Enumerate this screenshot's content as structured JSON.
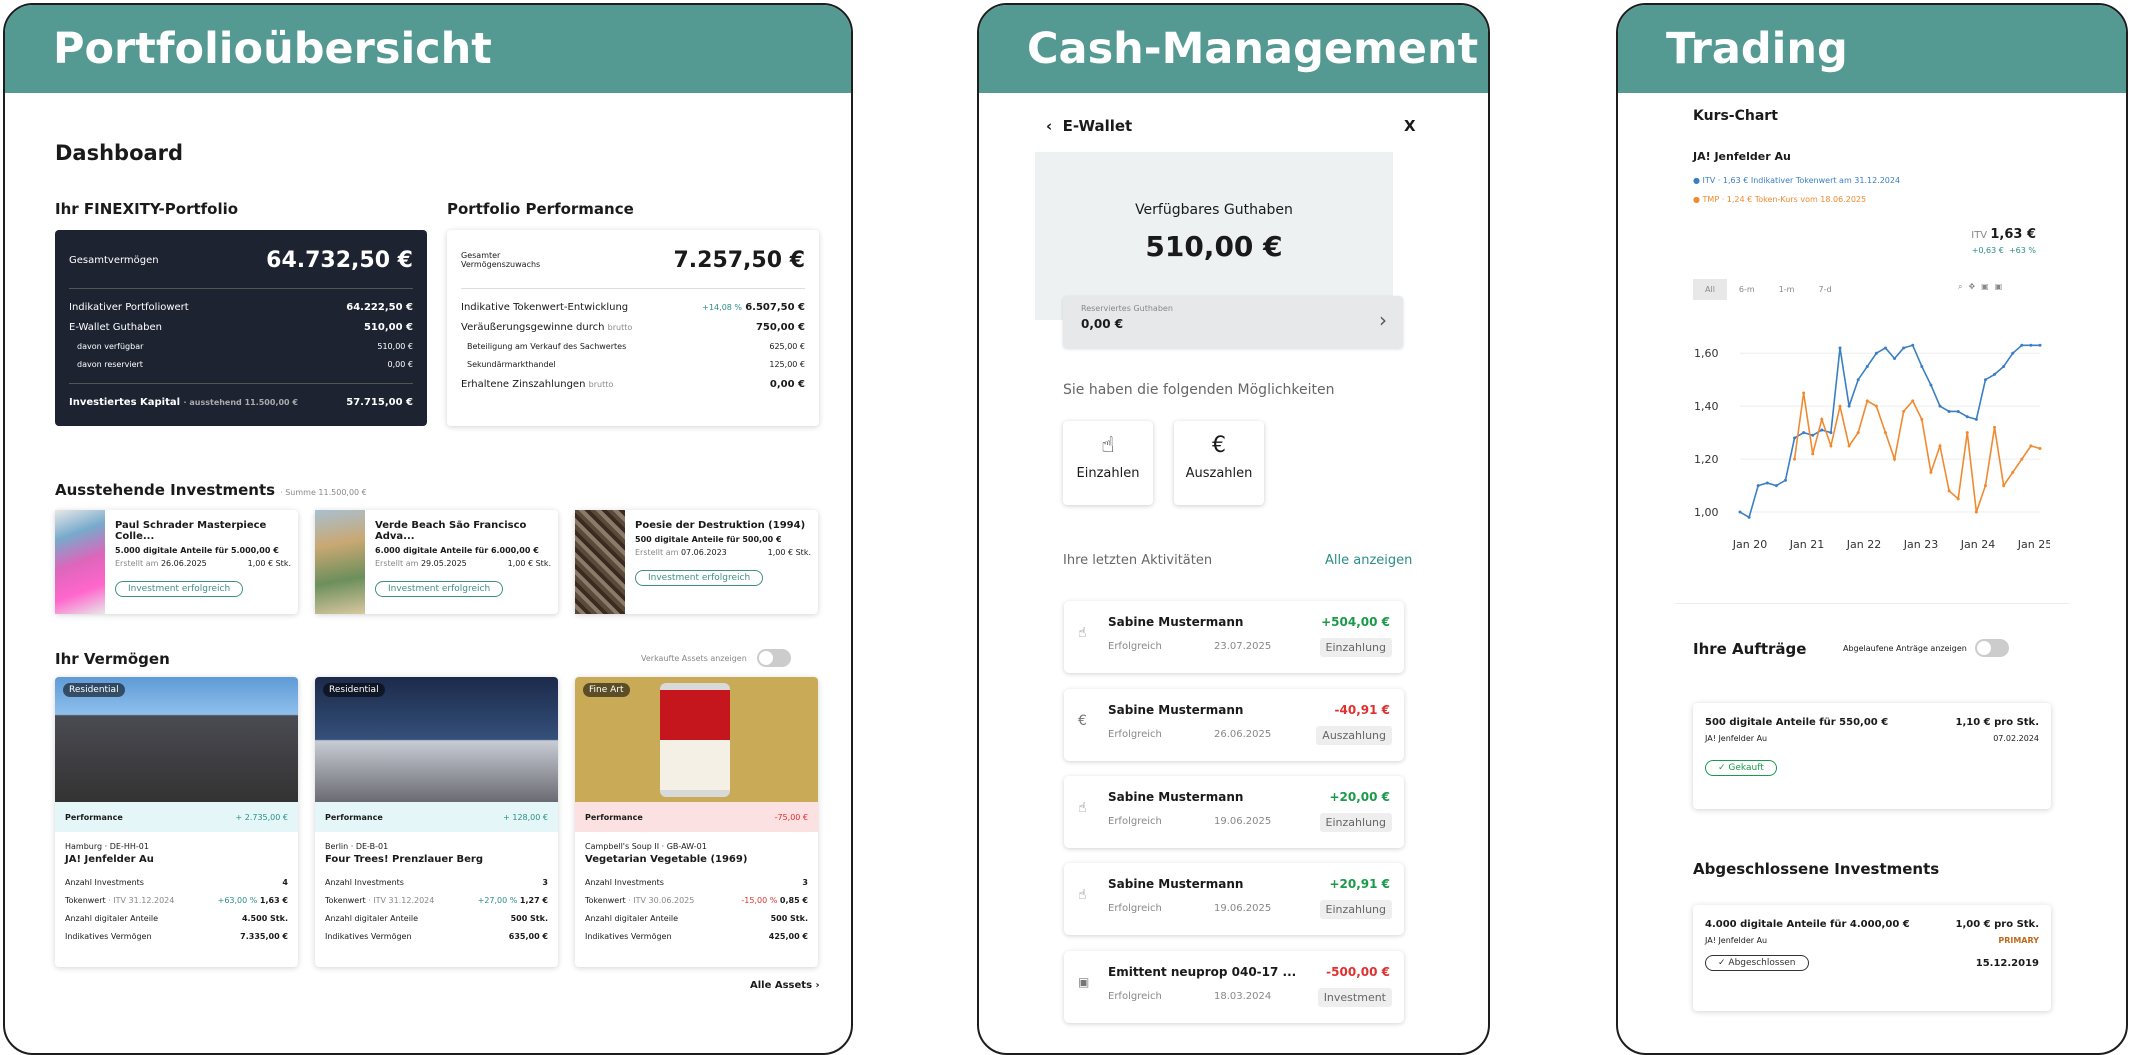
{
  "panels": {
    "p1": "Portfolioübersicht",
    "p2": "Cash-Management",
    "p3": "Trading"
  },
  "dash": {
    "title": "Dashboard",
    "portfolio_title": "Ihr FINEXITY-Portfolio",
    "gesamt_label": "Gesamtvermögen",
    "gesamt_value": "64.732,50 €",
    "lines": [
      {
        "l": "Indikativer Portfoliowert",
        "v": "64.222,50 €"
      },
      {
        "l": "E-Wallet Guthaben",
        "v": "510,00 €"
      },
      {
        "l": "davon verfügbar",
        "v": "510,00 €"
      },
      {
        "l": "davon reserviert",
        "v": "0,00 €"
      }
    ],
    "invest_label": "Investiertes Kapital",
    "invest_sub": "· ausstehend 11.500,00 €",
    "invest_value": "57.715,00 €",
    "perf_title": "Portfolio Performance",
    "perf_label": "Gesamter Vermögenszuwachs",
    "perf_value": "7.257,50 €",
    "perf_lines": [
      {
        "l": "Indikative Tokenwert-Entwicklung",
        "p": "+14,08 %",
        "v": "6.507,50 €"
      },
      {
        "l": "Veräußerungsgewinne durch",
        "p": "brutto",
        "v": "750,00 €"
      },
      {
        "l": "Beteiligung am Verkauf des Sachwertes",
        "p": "",
        "v": "625,00 €"
      },
      {
        "l": "Sekundärmarkthandel",
        "p": "",
        "v": "125,00 €"
      },
      {
        "l": "Erhaltene Zinszahlungen",
        "p": "brutto",
        "v": "0,00 €"
      }
    ],
    "pending_title": "Ausstehende Investments",
    "pending_sub": "· Summe 11.500,00 €",
    "pending": [
      {
        "name": "Paul Schrader Masterpiece Colle...",
        "shares": "5.000 digitale Anteile für 5.000,00 €",
        "created": "Erstellt am",
        "date": "26.06.2025",
        "stk": "1,00 € Stk.",
        "status": "Investment erfolgreich"
      },
      {
        "name": "Verde Beach São Francisco Adva...",
        "shares": "6.000 digitale Anteile für 6.000,00 €",
        "created": "Erstellt am",
        "date": "29.05.2025",
        "stk": "1,00 € Stk.",
        "status": "Investment erfolgreich"
      },
      {
        "name": "Poesie der Destruktion (1994)",
        "shares": "500 digitale Anteile für 500,00 €",
        "created": "Erstellt am",
        "date": "07.06.2023",
        "stk": "1,00 € Stk.",
        "status": "Investment erfolgreich"
      }
    ],
    "assets_title": "Ihr Vermögen",
    "sold_toggle": "Verkaufte Assets anzeigen",
    "assets": [
      {
        "badge": "Residential",
        "perf": "Performance",
        "perf_v": "+ 2.735,00 €",
        "loc": "Hamburg · DE-HH-01",
        "name": "JA! Jenfelder Au",
        "count_l": "Anzahl Investments",
        "count": "4",
        "tok_l": "Tokenwert",
        "tok_s": "· ITV 31.12.2024",
        "tok_p": "+63,00 %",
        "tok_v": "1,63 €",
        "anz_l": "Anzahl digitaler Anteile",
        "anz": "4.500 Stk.",
        "ind_l": "Indikatives Vermögen",
        "ind": "7.335,00 €"
      },
      {
        "badge": "Residential",
        "perf": "Performance",
        "perf_v": "+ 128,00 €",
        "loc": "Berlin · DE-B-01",
        "name": "Four Trees! Prenzlauer Berg",
        "count_l": "Anzahl Investments",
        "count": "3",
        "tok_l": "Tokenwert",
        "tok_s": "· ITV 31.12.2024",
        "tok_p": "+27,00 %",
        "tok_v": "1,27 €",
        "anz_l": "Anzahl digitaler Anteile",
        "anz": "500 Stk.",
        "ind_l": "Indikatives Vermögen",
        "ind": "635,00 €"
      },
      {
        "badge": "Fine Art",
        "perf": "Performance",
        "perf_v": "-75,00 €",
        "loc": "Campbell's Soup II · GB-AW-01",
        "name": "Vegetarian Vegetable (1969)",
        "count_l": "Anzahl Investments",
        "count": "3",
        "tok_l": "Tokenwert",
        "tok_s": "· ITV 30.06.2025",
        "tok_p": "-15,00 %",
        "tok_v": "0,85 €",
        "anz_l": "Anzahl digitaler Anteile",
        "anz": "500 Stk.",
        "ind_l": "Indikatives Vermögen",
        "ind": "425,00 €"
      }
    ],
    "all_assets": "Alle Assets"
  },
  "wallet": {
    "title": "E-Wallet",
    "close": "X",
    "avail_label": "Verfügbares Guthaben",
    "avail": "510,00 €",
    "res_label": "Reserviertes Guthaben",
    "res": "0,00 €",
    "options_title": "Sie haben die folgenden Möglichkeiten",
    "deposit": "Einzahlen",
    "withdraw": "Auszahlen",
    "recent": "Ihre letzten Aktivitäten",
    "all": "Alle anzeigen",
    "activities": [
      {
        "name": "Sabine Mustermann",
        "amt": "+504,00 €",
        "status": "Erfolgreich",
        "date": "23.07.2025",
        "type": "Einzahlung"
      },
      {
        "name": "Sabine Mustermann",
        "amt": "-40,91 €",
        "status": "Erfolgreich",
        "date": "26.06.2025",
        "type": "Auszahlung"
      },
      {
        "name": "Sabine Mustermann",
        "amt": "+20,00 €",
        "status": "Erfolgreich",
        "date": "19.06.2025",
        "type": "Einzahlung"
      },
      {
        "name": "Sabine Mustermann",
        "amt": "+20,91 €",
        "status": "Erfolgreich",
        "date": "19.06.2025",
        "type": "Einzahlung"
      },
      {
        "name": "Emittent neuprop 040-17 ...",
        "amt": "-500,00 €",
        "status": "Erfolgreich",
        "date": "18.03.2024",
        "type": "Investment"
      }
    ]
  },
  "trading": {
    "chart_title": "Kurs-Chart",
    "asset": "JA! Jenfelder Au",
    "leg1": "ITV · 1,63 € Indikativer Tokenwert am 31.12.2024",
    "leg2": "TMP · 1,24 € Token-Kurs vom 18.06.2025",
    "itv_label": "ITV",
    "itv": "1,63 €",
    "itv_abs": "+0,63 €",
    "itv_pct": "+63 %",
    "ranges": [
      "All",
      "6-m",
      "1-m",
      "7-d"
    ],
    "orders_title": "Ihre Aufträge",
    "expired_toggle": "Abgelaufene Anträge anzeigen",
    "order": {
      "desc": "500 digitale Anteile für 550,00 €",
      "price": "1,10 € pro Stk.",
      "asset": "JA! Jenfelder Au",
      "date": "07.02.2024",
      "status": "Gekauft"
    },
    "closed_title": "Abgeschlossene Investments",
    "closed": {
      "desc": "4.000 digitale Anteile für 4.000,00 €",
      "price": "1,00 € pro Stk.",
      "asset": "JA! Jenfelder Au",
      "market": "PRIMARY",
      "status": "Abgeschlossen",
      "date": "15.12.2019"
    }
  },
  "chart_data": {
    "type": "line",
    "title": "Kurs-Chart",
    "x": [
      "Jan 20",
      "Jan 21",
      "Jan 22",
      "Jan 23",
      "Jan 24",
      "Jan 25"
    ],
    "ylim": [
      1.0,
      1.65
    ],
    "yticks": [
      "1,60",
      "1,40",
      "1,20",
      "1,00"
    ],
    "series": [
      {
        "name": "ITV",
        "color": "#3a7fc4",
        "values": [
          1.0,
          0.98,
          1.1,
          1.11,
          1.1,
          1.12,
          1.28,
          1.3,
          1.29,
          1.31,
          1.3,
          1.62,
          1.4,
          1.5,
          1.55,
          1.6,
          1.62,
          1.58,
          1.62,
          1.63,
          1.55,
          1.48,
          1.4,
          1.38,
          1.38,
          1.36,
          1.35,
          1.5,
          1.52,
          1.55,
          1.6,
          1.63,
          1.63,
          1.63
        ]
      },
      {
        "name": "TMP",
        "color": "#f08a30",
        "values": [
          null,
          null,
          null,
          null,
          null,
          null,
          1.2,
          1.45,
          1.22,
          1.35,
          1.25,
          1.4,
          1.25,
          1.3,
          1.42,
          1.4,
          1.3,
          1.2,
          1.38,
          1.42,
          1.35,
          1.15,
          1.25,
          1.08,
          1.05,
          1.3,
          1.0,
          1.1,
          1.32,
          1.1,
          1.15,
          1.2,
          1.25,
          1.24
        ]
      }
    ]
  }
}
